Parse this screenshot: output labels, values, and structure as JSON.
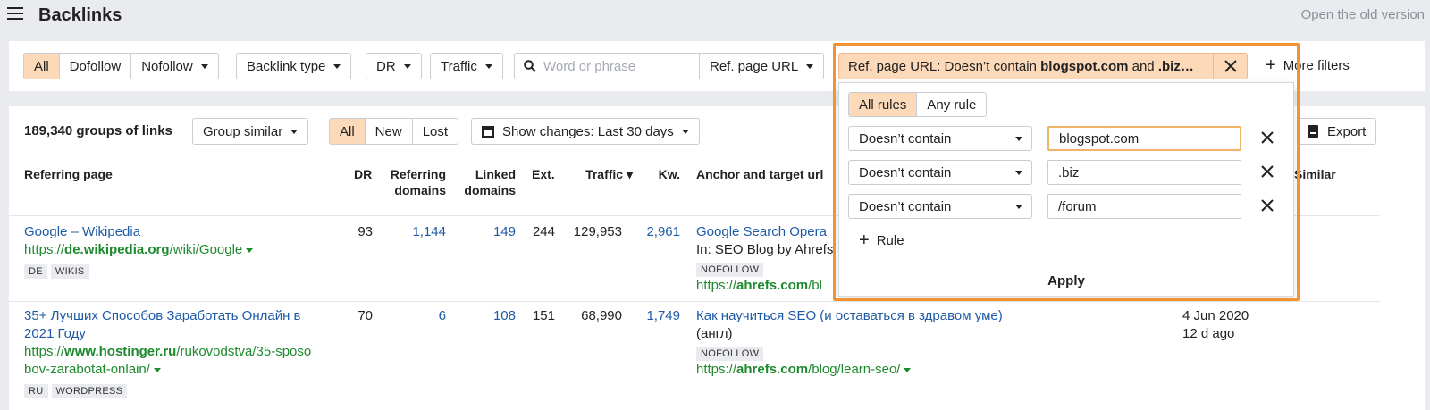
{
  "header": {
    "title": "Backlinks",
    "old_version_link": "Open the old version"
  },
  "filters": {
    "link_type": [
      "All",
      "Dofollow",
      "Nofollow"
    ],
    "backlink_type": "Backlink type",
    "dr": "DR",
    "traffic": "Traffic",
    "search_placeholder": "Word or phrase",
    "ref_page_url": "Ref. page URL",
    "active_filter": {
      "prefix": "Ref. page URL: Doesn’t contain ",
      "term1": "blogspot.com",
      "joiner": " and ",
      "term2": ".biz…"
    },
    "more_filters": "More filters"
  },
  "results": {
    "summary": "189,340 groups of links",
    "group_similar": "Group similar",
    "change_tabs": [
      "All",
      "New",
      "Lost"
    ],
    "show_changes": "Show changes: Last 30 days",
    "export": "Export"
  },
  "columns": {
    "referring_page": "Referring page",
    "dr": "DR",
    "referring_domains_1": "Referring",
    "referring_domains_2": "domains",
    "linked_domains_1": "Linked",
    "linked_domains_2": "domains",
    "ext": "Ext.",
    "traffic": "Traffic ▾",
    "kw": "Kw.",
    "anchor": "Anchor and target url",
    "similar": "Similar"
  },
  "rows": [
    {
      "title": "Google – Wikipedia",
      "url_prefix": "https://",
      "url_bold": "de.wikipedia.org",
      "url_rest": "/wiki/Google",
      "tags": [
        "DE",
        "WIKIS"
      ],
      "dr": "93",
      "ref_domains": "1,144",
      "linked_domains": "149",
      "ext": "244",
      "traffic": "129,953",
      "kw": "2,961",
      "anchor": "Google Search Opera",
      "anchor_sub": "In: SEO Blog by Ahrefs",
      "anchor_tag": "NOFOLLOW",
      "target_prefix": "https://",
      "target_bold": "ahrefs.com",
      "target_rest": "/bl"
    },
    {
      "title_1": "35+ Лучших Способов Заработать Онлайн в",
      "title_2": "2021 Году",
      "url_prefix": "https://",
      "url_bold": "www.hostinger.ru",
      "url_rest_1": "/rukovodstva/35-sposo",
      "url_rest_2": "bov-zarabotat-onlain/",
      "tags": [
        "RU",
        "WORDPRESS"
      ],
      "dr": "70",
      "ref_domains": "6",
      "linked_domains": "108",
      "ext": "151",
      "traffic": "68,990",
      "kw": "1,749",
      "anchor": "Как научиться SEO (и оставаться в здравом уме)",
      "anchor_sub": "(англ)",
      "anchor_tag": "NOFOLLOW",
      "target_prefix": "https://",
      "target_bold": "ahrefs.com",
      "target_rest": "/blog/learn-seo/",
      "date": "4 Jun 2020",
      "age": "12 d ago"
    }
  ],
  "popup": {
    "modes": [
      "All rules",
      "Any rule"
    ],
    "rules": [
      {
        "condition": "Doesn’t contain",
        "value": "blogspot.com"
      },
      {
        "condition": "Doesn’t contain",
        "value": ".biz"
      },
      {
        "condition": "Doesn’t contain",
        "value": "/forum"
      }
    ],
    "add_rule": "Rule",
    "apply": "Apply"
  },
  "colors": {
    "accent_orange": "#f1932e",
    "active_bg": "#fcd9b8",
    "link_blue": "#1f5aa6",
    "url_green": "#1e8a2e"
  }
}
